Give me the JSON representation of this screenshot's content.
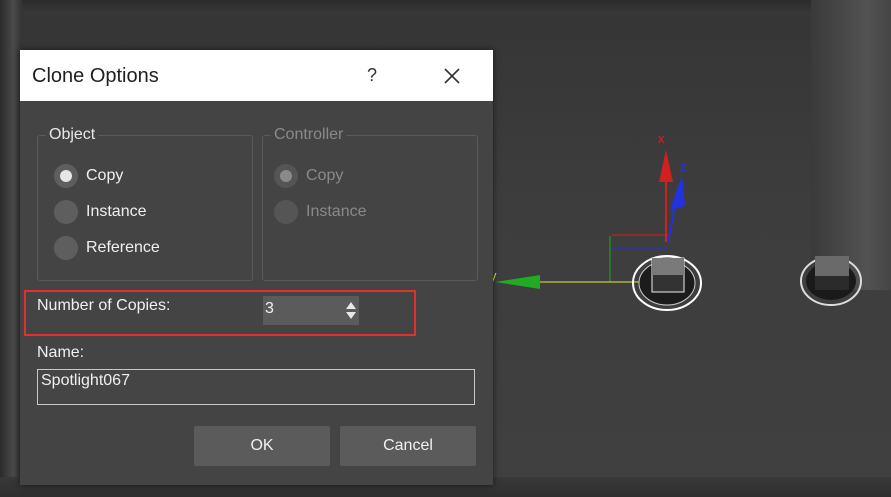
{
  "dialog": {
    "title": "Clone Options",
    "help_label": "?",
    "object_group": {
      "title": "Object",
      "options": [
        {
          "label": "Copy",
          "checked": true
        },
        {
          "label": "Instance",
          "checked": false
        },
        {
          "label": "Reference",
          "checked": false
        }
      ]
    },
    "controller_group": {
      "title": "Controller",
      "options": [
        {
          "label": "Copy",
          "checked": true
        },
        {
          "label": "Instance",
          "checked": false
        }
      ]
    },
    "copies": {
      "label": "Number of Copies:",
      "value": "3"
    },
    "name": {
      "label": "Name:",
      "value": "Spotlight067"
    },
    "buttons": {
      "ok": "OK",
      "cancel": "Cancel"
    }
  },
  "viewport": {
    "gizmo_labels": {
      "x": "x",
      "y": "y",
      "z": "z"
    },
    "axis_colors": {
      "x": "#e02020",
      "y": "#22aa22",
      "z": "#2233dd"
    }
  },
  "colors": {
    "highlight": "#e03030",
    "dialog_bg": "#444444",
    "titlebar": "#ffffff"
  }
}
